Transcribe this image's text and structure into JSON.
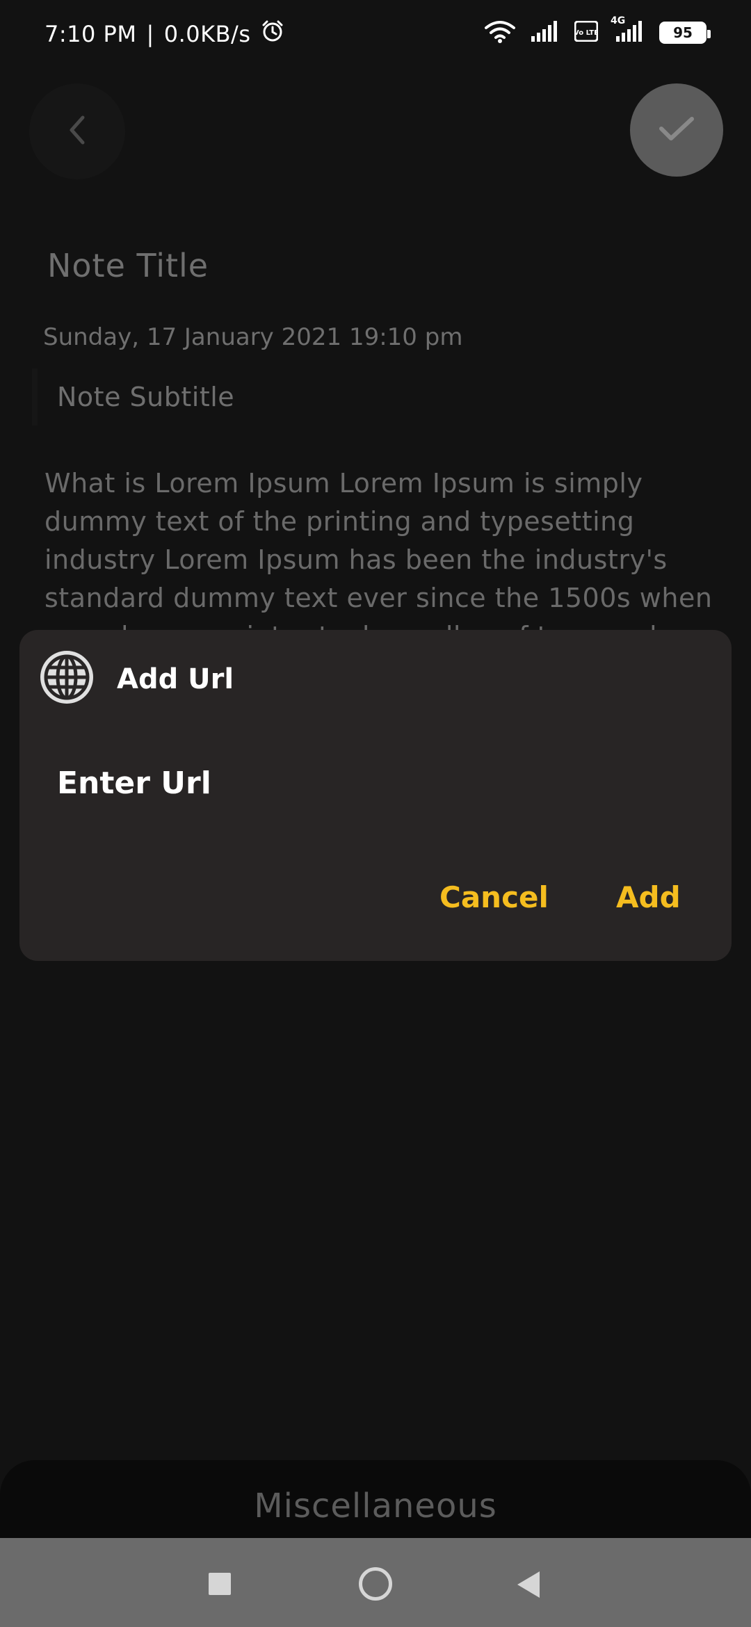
{
  "status_bar": {
    "time": "7:10 PM",
    "separator": "|",
    "net_speed": "0.0KB/s",
    "battery": "95",
    "volte": "Vo LTE",
    "network": "4G"
  },
  "note": {
    "title": "Note Title",
    "date": "Sunday, 17 January 2021 19:10 pm",
    "subtitle": "Note Subtitle",
    "body": "What is Lorem Ipsum Lorem Ipsum is simply dummy text of the printing and typesetting industry Lorem Ipsum has been the industry's standard dummy text ever since the 1500s when an unknown printer took a galley of type and scrambled it to make a type specimen book it has?"
  },
  "dialog": {
    "title": "Add Url",
    "input_placeholder": "Enter Url",
    "input_value": "",
    "cancel_label": "Cancel",
    "add_label": "Add"
  },
  "bottom_bar": {
    "label": "Miscellaneous"
  },
  "colors": {
    "accent": "#f5bd1f",
    "dialog_bg": "#282525",
    "page_bg": "#121212"
  },
  "icons": {
    "back": "chevron-left-icon",
    "save": "check-icon",
    "dialog": "globe-icon",
    "alarm": "alarm-icon",
    "wifi": "wifi-icon",
    "signal": "signal-icon"
  }
}
